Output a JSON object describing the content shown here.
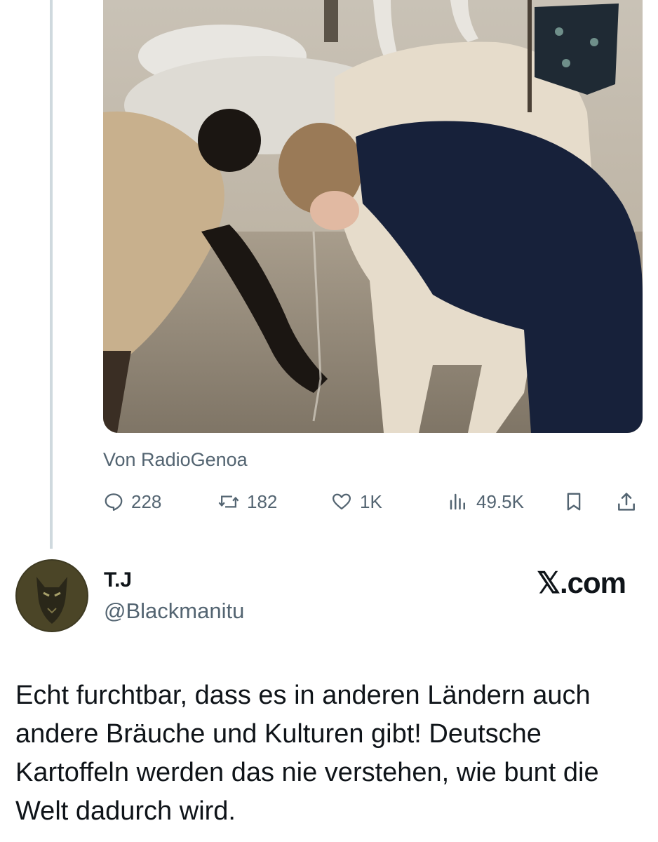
{
  "media": {
    "source_label": "Von RadioGenoa",
    "mute_icon": "speaker-muted-icon"
  },
  "actions": {
    "replies": "228",
    "reposts": "182",
    "likes": "1K",
    "views": "49.5K"
  },
  "author": {
    "display_name": "T.J",
    "handle": "@Blackmanitu"
  },
  "watermark": "𝕏.com",
  "tweet_text": "Echt furchtbar, dass es in anderen Ländern auch andere Bräuche und Kulturen gibt! Deutsche Kartoffeln werden das nie verstehen, wie bunt die Welt dadurch wird.",
  "colors": {
    "secondary_text": "#536471",
    "primary_text": "#0f1419",
    "thread_line": "#cfd9de"
  }
}
